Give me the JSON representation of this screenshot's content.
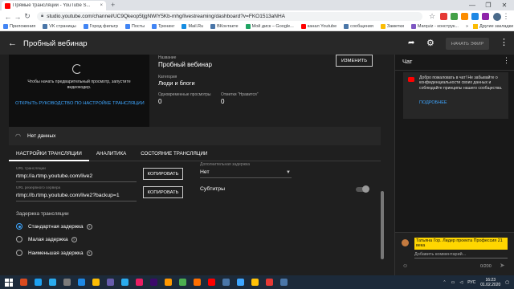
{
  "browser": {
    "tab_title": "Прямые трансляции - YouTube S...",
    "tab_close": "×",
    "new_tab": "+",
    "url": "studio.youtube.com/channel/UC9Qkeop5tjgNWlY5Kb-mhg/livestreaming/dashboard?v=FKO1513aNHA",
    "window_controls": [
      "—",
      "❐",
      "✕"
    ],
    "bookmarks": [
      {
        "label": "Приложения",
        "color": "#4285f4"
      },
      {
        "label": "VK страницы",
        "color": "#4a76a8"
      },
      {
        "label": "Город фильтр",
        "color": "#4285f4"
      },
      {
        "label": "Посты",
        "color": "#4285f4"
      },
      {
        "label": "Тренинг",
        "color": "#4285f4"
      },
      {
        "label": "Mail.Ru",
        "color": "#168de2"
      },
      {
        "label": "ВКонтакте",
        "color": "#4a76a8"
      },
      {
        "label": "Мой диск – Google...",
        "color": "#1fa463"
      },
      {
        "label": "канал Youtube",
        "color": "#ff0000"
      },
      {
        "label": "сообщения",
        "color": "#4a76a8"
      },
      {
        "label": "Заметки",
        "color": "#fbbc04"
      },
      {
        "label": "Marquiz - конструк...",
        "color": "#7e57c2"
      }
    ],
    "bookmarks_overflow": "»",
    "other_bookmarks": "Другие закладки"
  },
  "header": {
    "title": "Пробный вебинар",
    "start_button": "НАЧАТЬ ЭФИР"
  },
  "preview": {
    "message": "Чтобы начать предварительный просмотр, запустите видеокодер.",
    "guide_link": "ОТКРЫТЬ РУКОВОДСТВО ПО НАСТРОЙКЕ ТРАНСЛЯЦИИ"
  },
  "info": {
    "name_label": "Название",
    "name_value": "Пробный вебинар",
    "category_label": "Категория",
    "category_value": "Люди и блоги",
    "viewers_label": "Одновременные просмотры",
    "viewers_value": "0",
    "likes_label": "Отметки \"Нравится\"",
    "likes_value": "0",
    "edit_button": "ИЗМЕНИТЬ"
  },
  "status": {
    "no_data": "Нет данных"
  },
  "tabs": [
    "НАСТРОЙКИ ТРАНСЛЯЦИИ",
    "АНАЛИТИКА",
    "СОСТОЯНИЕ ТРАНСЛЯЦИИ"
  ],
  "settings": {
    "url_label": "URL трансляции",
    "url_value": "rtmp://a.rtmp.youtube.com/live2",
    "backup_label": "URL резервного сервера",
    "backup_value": "rtmp://b.rtmp.youtube.com/live2?backup=1",
    "copy_button": "КОПИРОВАТЬ",
    "delay_label": "Дополнительная задержка",
    "delay_value": "Нет",
    "subtitles_label": "Субтитры",
    "subtitles_on": false,
    "latency_title": "Задержка трансляции",
    "latency_options": [
      {
        "label": "Стандартная задержка",
        "selected": true
      },
      {
        "label": "Малая задержка",
        "selected": false
      },
      {
        "label": "Наименьшая задержка",
        "selected": false
      }
    ],
    "help_glyph": "?"
  },
  "chat": {
    "title": "Чат",
    "welcome": "Добро пожаловать в чат! Не забывайте о конфиденциальности своих данных и соблюдайте принципы нашего сообщества.",
    "learn_more": "ПОДРОБНЕЕ",
    "author": "Татьяна Гор. Лидер проекта Профессия 21 века",
    "input_placeholder": "Добавить комментарий...",
    "char_count": "0/200"
  },
  "taskbar": {
    "apps": [
      "#d84b20",
      "#1da1f2",
      "#2aabee",
      "#7b7b7b",
      "#1e88e5",
      "#fbbc04",
      "#665cac",
      "#2aabee",
      "#e91e63",
      "#3b0a6b",
      "#ff9800",
      "#4caf50",
      "#ff6f00",
      "#ff0000",
      "#4a76a8",
      "#3ea6ff",
      "#ffc107",
      "#e53935",
      "#4a76a8"
    ],
    "lang": "РУС",
    "time": "16:23",
    "date": "01.02.2020"
  }
}
